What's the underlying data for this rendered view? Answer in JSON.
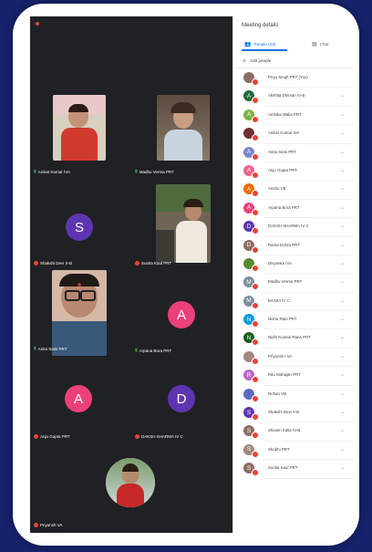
{
  "panel": {
    "title": "Meeting details",
    "tab_people": "People (23)",
    "tab_chat": "Chat",
    "add_people": "Add people"
  },
  "tiles": [
    {
      "name": "Aniket Kumar IVA",
      "mic": "green"
    },
    {
      "name": "Madhu Verma PRT",
      "mic": "green"
    },
    {
      "name": "Shakshi Devi X-B",
      "mic": "red",
      "initial": "S"
    },
    {
      "name": "Sunita Kaul PRT",
      "mic": "red"
    },
    {
      "name": "Anita Saini PRT",
      "mic": "green"
    },
    {
      "name": "Arpana Bora PRT",
      "mic": "green",
      "initial": "A"
    },
    {
      "name": "Anju Gupta PRT",
      "mic": "red",
      "initial": "A"
    },
    {
      "name": "DAKSH SHARMA IV C",
      "mic": "red",
      "initial": "D"
    },
    {
      "name": "Priyansh VA",
      "mic": "red"
    }
  ],
  "participants": [
    {
      "name": "Priya Singh PRT (You)",
      "initial": "",
      "color": "#8d6e63"
    },
    {
      "name": "Akshita Dhiman IV-B",
      "initial": "A",
      "color": "#1e6b3a"
    },
    {
      "name": "Ambika Walia PRT",
      "initial": "A",
      "color": "#7cb342"
    },
    {
      "name": "Aniket Kumar IVA",
      "initial": "",
      "color": "#6d2f2f"
    },
    {
      "name": "Anita Saini PRT",
      "initial": "A",
      "color": "#7986cb"
    },
    {
      "name": "Anju Gupta PRT",
      "initial": "A",
      "color": "#f06292"
    },
    {
      "name": "Anshu VB",
      "initial": "A",
      "color": "#ef6c00"
    },
    {
      "name": "Arpana Bora PRT",
      "initial": "A",
      "color": "#ec407a"
    },
    {
      "name": "DAKSH SHARMA IV C",
      "initial": "D",
      "color": "#5e35b1"
    },
    {
      "name": "Rama Dohra PRT",
      "initial": "D",
      "color": "#8d6e63"
    },
    {
      "name": "Divyanka IVA",
      "initial": "",
      "color": "#558b2f"
    },
    {
      "name": "Madhu Verma PRT",
      "initial": "M",
      "color": "#78909c"
    },
    {
      "name": "MANVI IV C",
      "initial": "M",
      "color": "#78909c"
    },
    {
      "name": "Nisha Rani PRT",
      "initial": "N",
      "color": "#039be5"
    },
    {
      "name": "Nidhi Kumari Rana PRT",
      "initial": "N",
      "color": "#1b5e20"
    },
    {
      "name": "Priyansh I VA",
      "initial": "",
      "color": "#a1887f"
    },
    {
      "name": "Ritu Mahajan PRT",
      "initial": "R",
      "color": "#ba68c8"
    },
    {
      "name": "Rohan VB",
      "initial": "",
      "color": "#5c6bc0"
    },
    {
      "name": "Shakshi Devi X-B",
      "initial": "S",
      "color": "#5e35b1"
    },
    {
      "name": "Shivam Kalia IV-B",
      "initial": "S",
      "color": "#8d6e63"
    },
    {
      "name": "Shobhi PRT",
      "initial": "S",
      "color": "#a1887f"
    },
    {
      "name": "Sunita Kaul PRT",
      "initial": "S",
      "color": "#8d6e63"
    }
  ]
}
